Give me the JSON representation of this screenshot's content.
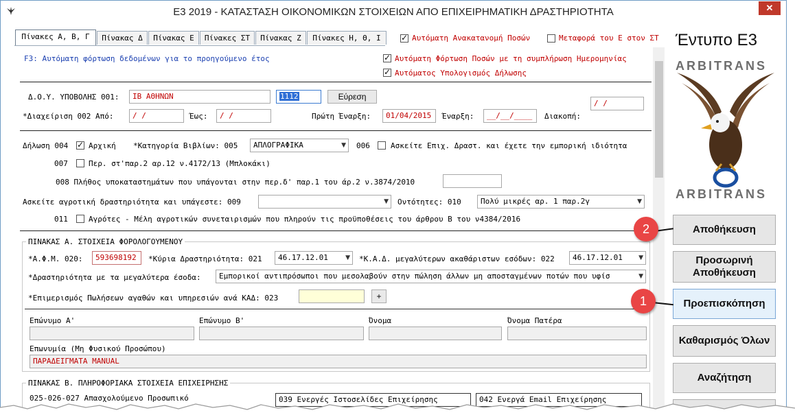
{
  "window": {
    "title": "E3 2019 - ΚΑΤΑΣΤΑΣΗ ΟΙΚΟΝΟΜΙΚΩΝ ΣΤΟΙΧΕΙΩΝ ΑΠΟ ΕΠΙΧΕΙΡΗΜΑΤΙΚΗ ΔΡΑΣΤΗΡΙΟΤΗΤΑ",
    "close_label": "✕"
  },
  "tabs": [
    {
      "label": "Πίνακες Α, Β, Γ"
    },
    {
      "label": "Πίνακας Δ"
    },
    {
      "label": "Πίνακας Ε"
    },
    {
      "label": "Πίνακες ΣΤ"
    },
    {
      "label": "Πίνακας Ζ"
    },
    {
      "label": "Πίνακες Η, Θ, Ι"
    }
  ],
  "options": {
    "auto_redistribution": {
      "label": "Αυτόματη Ανακατανομή Ποσών",
      "checked": true
    },
    "transfer_to_e": {
      "label": "Μεταφορά του Ε στον ΣΤ",
      "checked": false
    },
    "auto_load": {
      "label": "Αυτόματη Φόρτωση Ποσών με τη συμπλήρωση Ημερομηνίας",
      "checked": true
    },
    "auto_calc": {
      "label": "Αυτόματος Υπολογισμός Δήλωσης",
      "checked": true
    },
    "f3_hint": "F3: Αυτόματη φόρτωση δεδομένων για το προηγούμενο έτος"
  },
  "doy": {
    "label": "Δ.Ο.Υ. ΥΠΟΒΟΛΗΣ 001:",
    "value": "ΙΒ ΑΘΗΝΩΝ",
    "code": "1112",
    "search_btn": "Εύρεση"
  },
  "period": {
    "label": "*Διαχείριση  002 Από:",
    "from": "  /  /",
    "to_label": "Έως:",
    "to": "  /  /",
    "first_start_label": "Πρώτη Έναρξη:",
    "first_start": "01/04/2015",
    "start_label": "Έναρξη:",
    "start": "__/__/____",
    "stop_label": "Διακοπή:",
    "stop": "  /  /"
  },
  "declaration": {
    "label": "Δήλωση 004",
    "initial_label": "Αρχική",
    "initial_checked": true,
    "books_label": "*Κατηγορία Βιβλίων: 005",
    "books_value": "ΑΠΛΟΓΡΑΦΙΚΑ",
    "c006_code": "006",
    "c006_label": "Ασκείτε Επιχ. Δραστ. και έχετε την εμπορική ιδιότητα",
    "c007_code": "007",
    "c007_label": "Περ. στ'παρ.2 αρ.12 ν.4172/13 (Μπλοκάκι)",
    "c008_label": "008 Πλήθος υποκαταστημάτων που υπάγονται στην περ.δ' παρ.1 του άρ.2 ν.3874/2010",
    "c009_label": "Ασκείτε αγροτική δραστηριότητα και υπάγεστε: 009",
    "c009_value": "",
    "c010_label": "Οντότητες: 010",
    "c010_value": "Πολύ μικρές αρ. 1 παρ.2γ",
    "c011_code": "011",
    "c011_label": "Αγρότες - Μέλη αγροτικών συνεταιρισμών που πληρούν τις προϋποθέσεις του άρθρου Β του ν4384/2016"
  },
  "table_a": {
    "title": "ΠΙΝΑΚΑΣ Α. ΣΤΟΙΧΕΙΑ ΦΟΡΟΛΟΓΟΥΜΕΝΟΥ",
    "afm_label": "*Α.Φ.Μ. 020:",
    "afm": "593698192",
    "main_act_label": "*Κύρια Δραστηριότητα: 021",
    "main_act": "46.17.12.01",
    "kad_label": "*Κ.Α.Δ. μεγαλύτερων ακαθάριστων εσόδων: 022",
    "kad": "46.17.12.01",
    "top_act_label": "*Δραστηριότητα με τα μεγαλύτερα έσοδα:",
    "top_act": "Εμπορικοί αντιπρόσωποι που μεσολαβούν στην πώληση άλλων μη αποσταγμένων ποτών που υφίσ",
    "split_label": "*Επιμερισμός Πωλήσεων αγαθών και υπηρεσιών ανά ΚΑΔ: 023",
    "split_btn": "+",
    "surname_a": "Επώνυμο Α'",
    "surname_b": "Επώνυμο Β'",
    "name": "Όνομα",
    "father": "Όνομα Πατέρα",
    "company_label": "Επωνυμία (Μη Φυσικού Προσώπου)",
    "company": "ΠΑΡΑΔΕΙΓΜΑΤΑ MANUAL"
  },
  "table_b": {
    "title": "ΠΙΝΑΚΑΣ Β. ΠΛΗΡΟΦΟΡΙΑΚΑ ΣΤΟΙΧΕΙΑ ΕΠΙΧΕΙΡΗΣΗΣ",
    "staff_label": "025-026-027 Απασχολούμενο Προσωπικό",
    "box039": "039 Ενεργές Ιστοσελίδες Επιχείρησης",
    "box042": "042 Ενεργά Email Επιχείρησης"
  },
  "side": {
    "form_title": "Έντυπο Ε3",
    "brand_top": "ARBITRANS",
    "brand_bottom": "ARBITRANS",
    "buttons": [
      {
        "label": "Αποθήκευση"
      },
      {
        "label": "Προσωρινή Αποθήκευση"
      },
      {
        "label": "Προεπισκόπηση"
      },
      {
        "label": "Καθαρισμός Όλων"
      },
      {
        "label": "Αναζήτηση"
      }
    ],
    "badge1": "1",
    "badge2": "2"
  },
  "colors": {
    "accent_red": "#c00000",
    "badge": "#e94545",
    "hint_blue": "#1a3fb0"
  }
}
